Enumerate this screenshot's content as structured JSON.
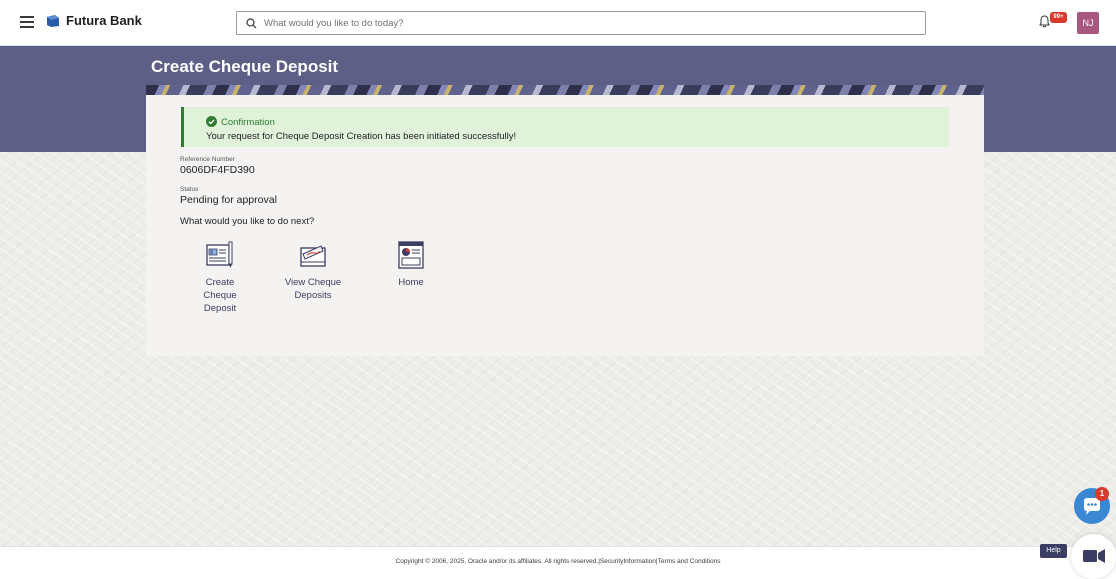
{
  "header": {
    "brand_name": "Futura Bank",
    "search_placeholder": "What would you like to do today?",
    "notification_badge": "99+",
    "avatar_initials": "NJ"
  },
  "page": {
    "title": "Create Cheque Deposit"
  },
  "confirmation": {
    "title": "Confirmation",
    "message": "Your request for Cheque Deposit Creation has been initiated successfully!"
  },
  "details": {
    "reference_label": "Reference Number",
    "reference_value": "0606DF4FD390",
    "status_label": "Status",
    "status_value": "Pending for approval"
  },
  "next_steps": {
    "question": "What would you like to do next?",
    "actions": [
      {
        "line1": "Create Cheque",
        "line2": "Deposit",
        "icon": "cheque-form-icon"
      },
      {
        "line1": "View Cheque",
        "line2": "Deposits",
        "icon": "cheque-envelope-icon"
      },
      {
        "line1": "Home",
        "line2": "",
        "icon": "dashboard-home-icon"
      }
    ]
  },
  "chatbot": {
    "badge": "1"
  },
  "footer": {
    "copyright": "Copyright © 2006, 2025, Oracle and/or its affiliates. All rights reserved.|SecurityInformation|Terms and Conditions",
    "help_label": "Help"
  },
  "colors": {
    "banner": "#5d5f86",
    "success": "#2e7d32",
    "success_bg": "#e0f2da",
    "link": "#3b3d62",
    "avatar": "#a8577e",
    "chatbot": "#3a88d4"
  }
}
